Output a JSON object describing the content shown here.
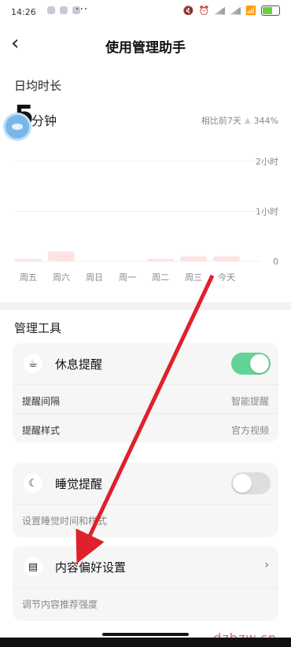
{
  "status": {
    "time": "14:26",
    "dots": "···"
  },
  "header": {
    "back_icon": "back-icon",
    "title": "使用管理助手"
  },
  "usage": {
    "section_label": "日均时长",
    "value": "5",
    "unit": "分钟",
    "compare_label": "相比前7天",
    "compare_value": "344%"
  },
  "chart_data": {
    "type": "bar",
    "categories": [
      "周五",
      "周六",
      "周日",
      "周一",
      "周二",
      "周三",
      "今天"
    ],
    "values": [
      3,
      12,
      0,
      0,
      3,
      6,
      6
    ],
    "value_unit": "分钟",
    "y_ticks": [
      "2小时",
      "1小时",
      "0"
    ],
    "ylim": [
      0,
      120
    ],
    "bar_color": "#fde3e3",
    "grid": true
  },
  "tools": {
    "section_label": "管理工具",
    "rest": {
      "name": "休息提醒",
      "icon": "cup-icon",
      "enabled": true,
      "rows": [
        {
          "label": "提醒间隔",
          "value": "智能提醒"
        },
        {
          "label": "提醒样式",
          "value": "官方视频"
        }
      ]
    },
    "sleep": {
      "name": "睡觉提醒",
      "icon": "moon-icon",
      "enabled": false,
      "sub": "设置睡觉时间和样式"
    },
    "content": {
      "name": "内容偏好设置",
      "icon": "content-settings-icon",
      "sub": "调节内容推荐强度"
    }
  },
  "watermark": "dzbzw.cn",
  "colors": {
    "toggle_on": "#62d396",
    "arrow": "#e0202a",
    "bar": "#fde3e3"
  }
}
